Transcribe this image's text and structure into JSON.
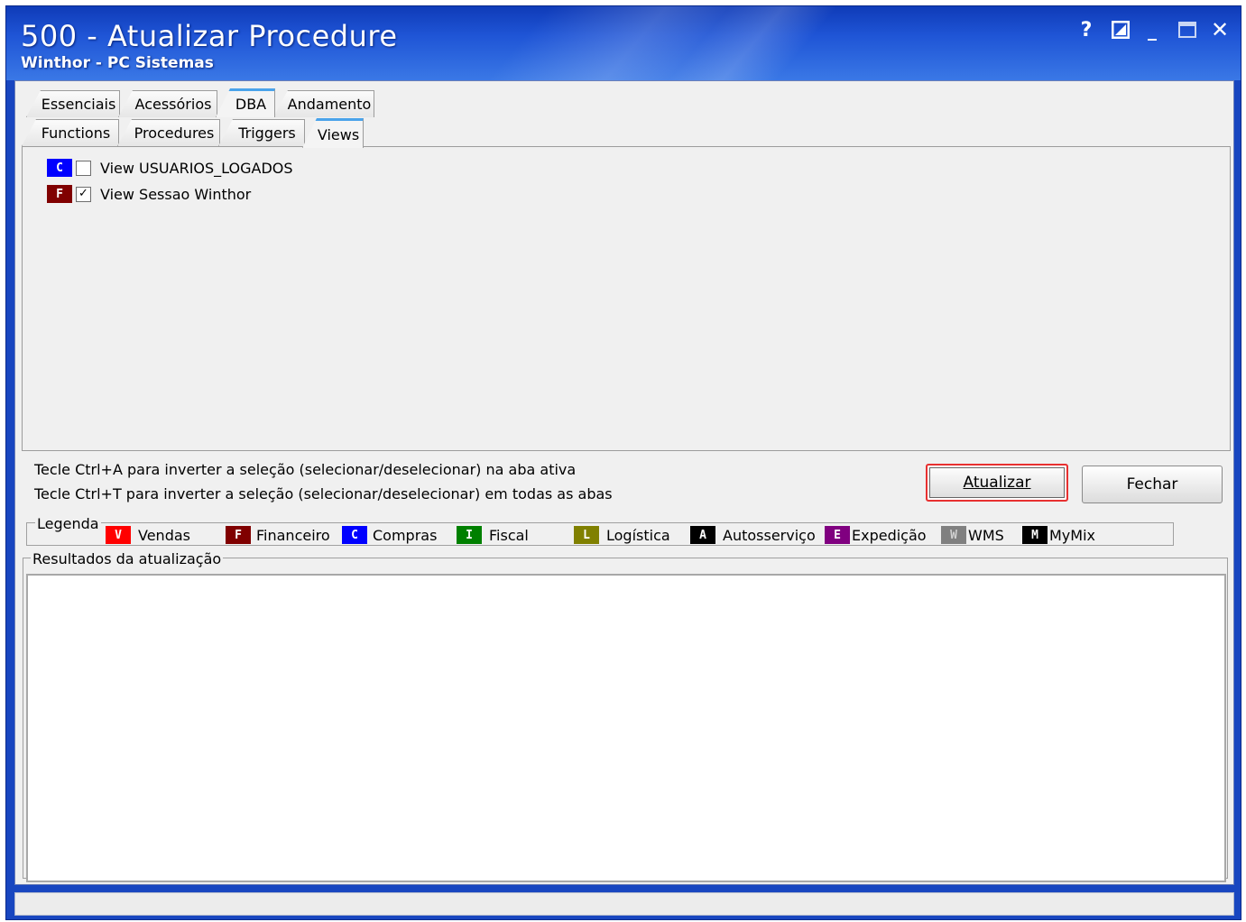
{
  "window": {
    "title": "500 - Atualizar Procedure",
    "subtitle": "Winthor - PC Sistemas",
    "controls": {
      "help": "?",
      "minimize": "_",
      "close": "✕"
    }
  },
  "tabs_row1": [
    "Essenciais",
    "Acessórios",
    "DBA",
    "Andamento"
  ],
  "tabs_row2": [
    "Functions",
    "Procedures",
    "Triggers",
    "Views"
  ],
  "active_tab_row1": "DBA",
  "active_tab_row2": "Views",
  "items": [
    {
      "badge": "C",
      "badge_color": "#0000ff",
      "checked": false,
      "check_mark": "",
      "label": "View USUARIOS_LOGADOS"
    },
    {
      "badge": "F",
      "badge_color": "#800000",
      "checked": true,
      "check_mark": "✓",
      "label": "View Sessao Winthor"
    }
  ],
  "hints": [
    "Tecle Ctrl+A para inverter a seleção (selecionar/deselecionar) na aba ativa",
    "Tecle Ctrl+T para inverter a seleção (selecionar/deselecionar) em todas as abas"
  ],
  "buttons": {
    "update": "Atualizar",
    "close": "Fechar"
  },
  "legend": {
    "title": "Legenda",
    "entries": [
      {
        "badge": "V",
        "color": "#ff0000",
        "label": "Vendas"
      },
      {
        "badge": "F",
        "color": "#800000",
        "label": "Financeiro"
      },
      {
        "badge": "C",
        "color": "#0000ff",
        "label": "Compras"
      },
      {
        "badge": "I",
        "color": "#008000",
        "label": "Fiscal"
      },
      {
        "badge": "L",
        "color": "#808000",
        "label": "Logística"
      },
      {
        "badge": "A",
        "color": "#000000",
        "label": "Autosserviço"
      },
      {
        "badge": "E",
        "color": "#800080",
        "label": "Expedição"
      },
      {
        "badge": "W",
        "color": "#808080",
        "label": "WMS"
      },
      {
        "badge": "M",
        "color": "#000000",
        "label": "MyMix"
      }
    ]
  },
  "results": {
    "title": "Resultados da atualização",
    "content": ""
  }
}
